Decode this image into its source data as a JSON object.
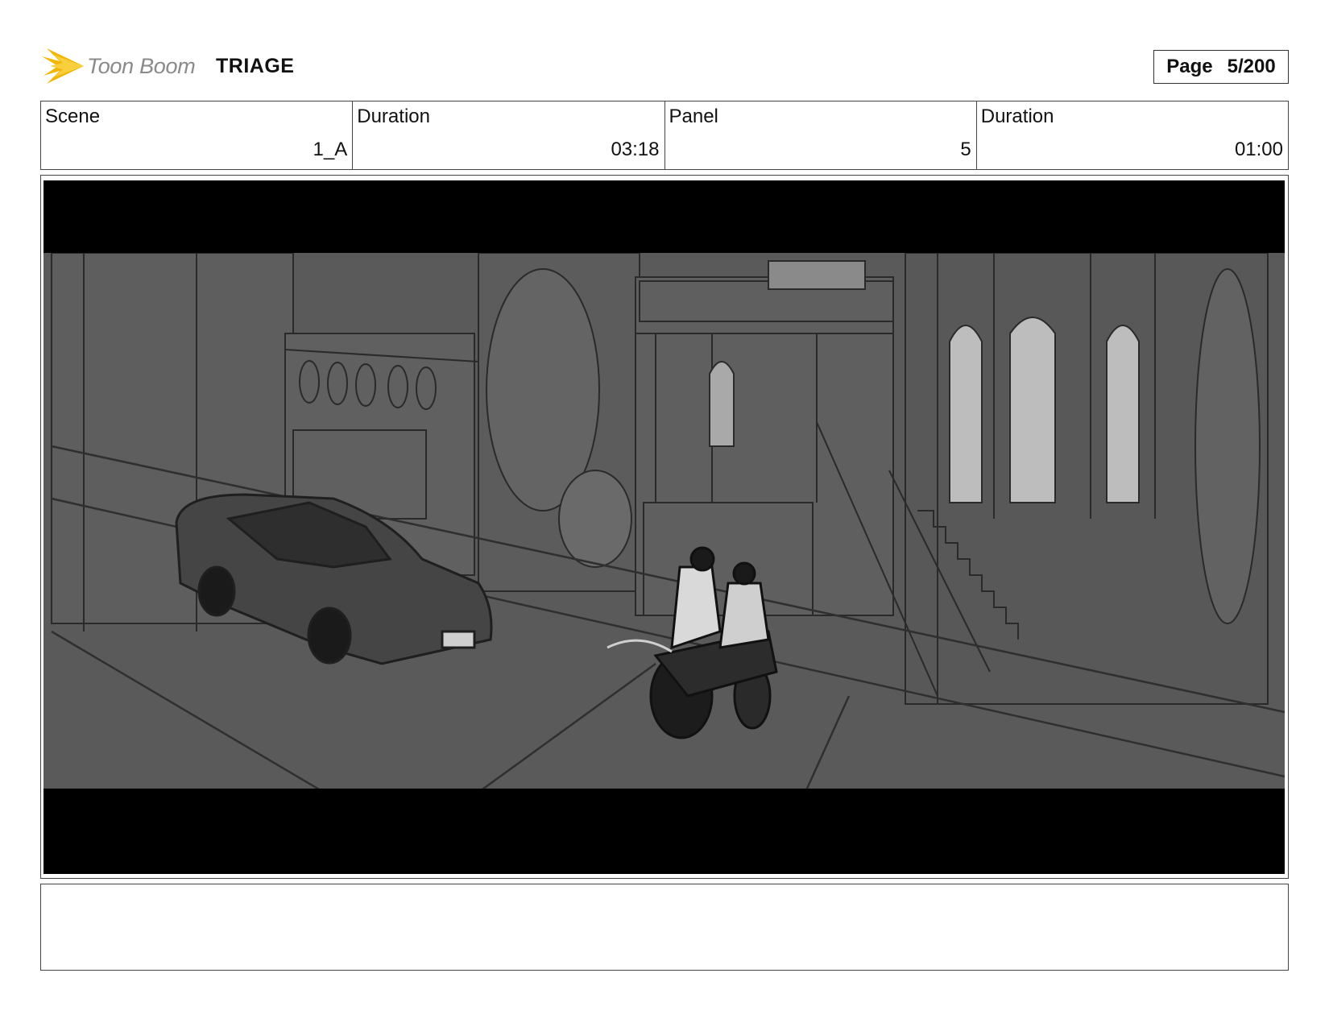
{
  "header": {
    "logo_text": "Toon Boom",
    "project_title": "TRIAGE",
    "page_label": "Page",
    "page_value": "5/200"
  },
  "info": {
    "scene_label": "Scene",
    "scene_value": "1_A",
    "scene_duration_label": "Duration",
    "scene_duration_value": "03:18",
    "panel_label": "Panel",
    "panel_value": "5",
    "panel_duration_label": "Duration",
    "panel_duration_value": "01:00"
  },
  "panel": {
    "image_icon": "storyboard-sketch",
    "description": "",
    "colors": {
      "letterbox": "#000000",
      "sketch_bg": "#5a5a5a"
    }
  },
  "notes": {
    "text": ""
  },
  "brand_color": "#f2b705"
}
